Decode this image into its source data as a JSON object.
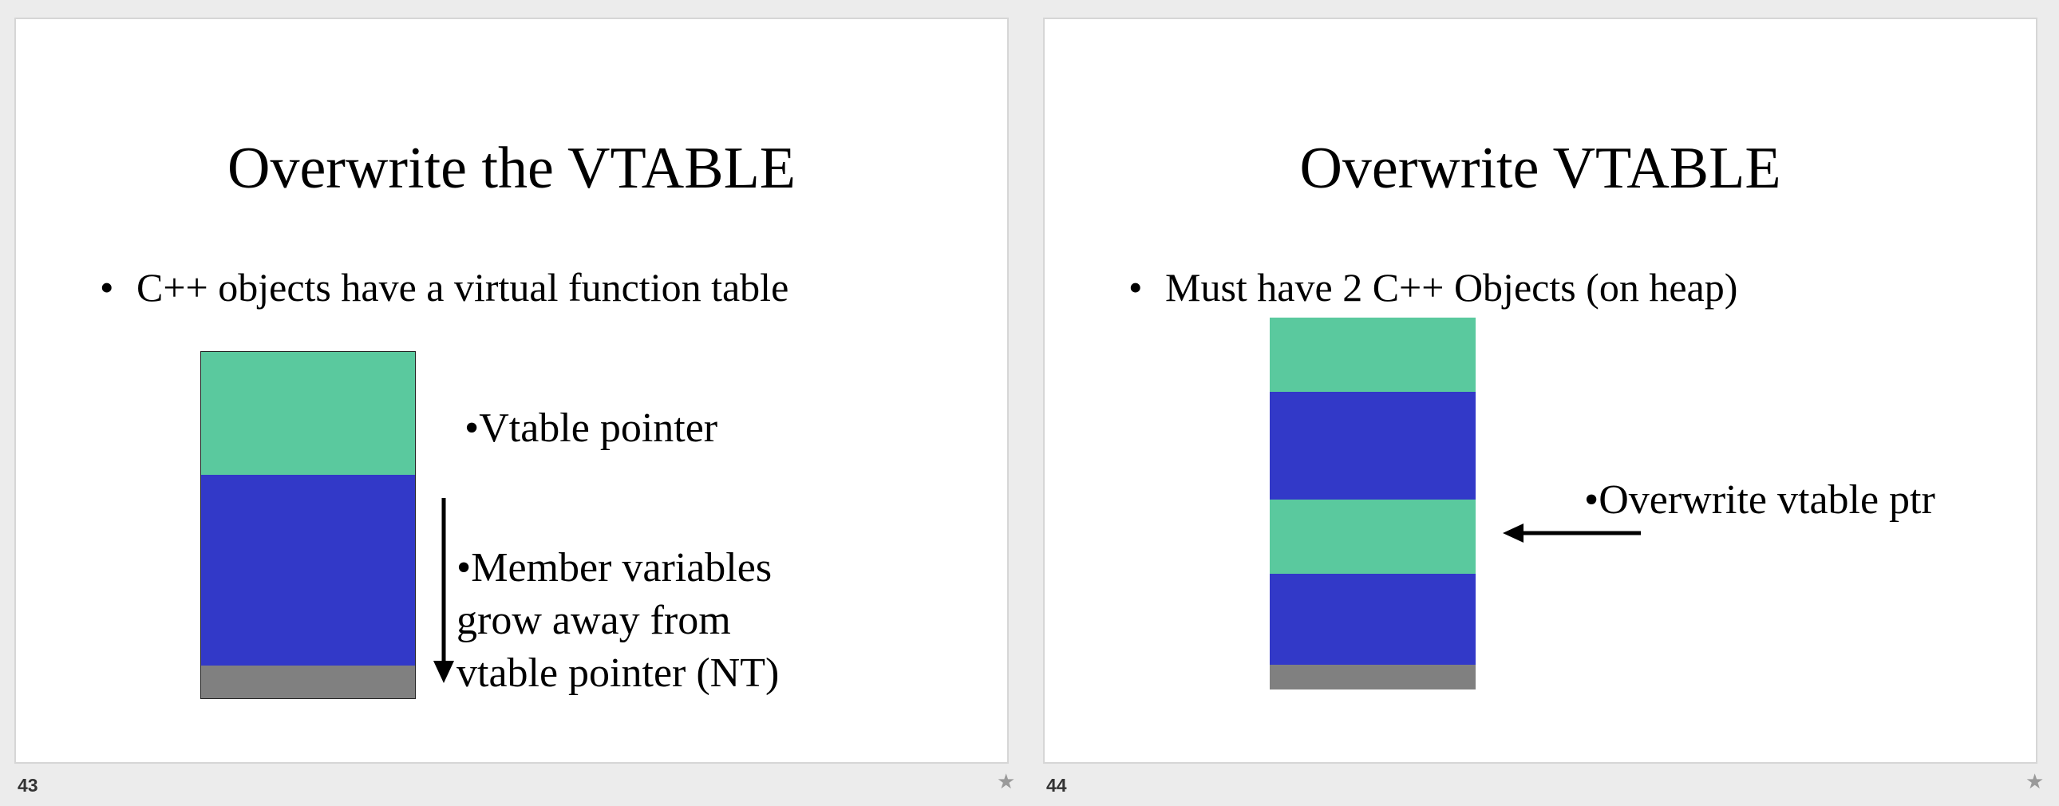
{
  "colors": {
    "vtable_green": "#5ac99e",
    "member_blue": "#3239c8",
    "heap_gray": "#808080",
    "background": "#ececec"
  },
  "slides": [
    {
      "number": "43",
      "title": "Overwrite the VTABLE",
      "bullet": "C++ objects have a virtual function table",
      "vtable_label": "•Vtable pointer",
      "member_lines": [
        "•Member variables",
        "grow away from",
        "vtable pointer (NT)"
      ],
      "star_icon": "star-icon"
    },
    {
      "number": "44",
      "title": "Overwrite VTABLE",
      "bullet": "Must have 2 C++ Objects (on heap)",
      "overwrite_label": "•Overwrite vtable ptr",
      "star_icon": "star-icon"
    }
  ]
}
